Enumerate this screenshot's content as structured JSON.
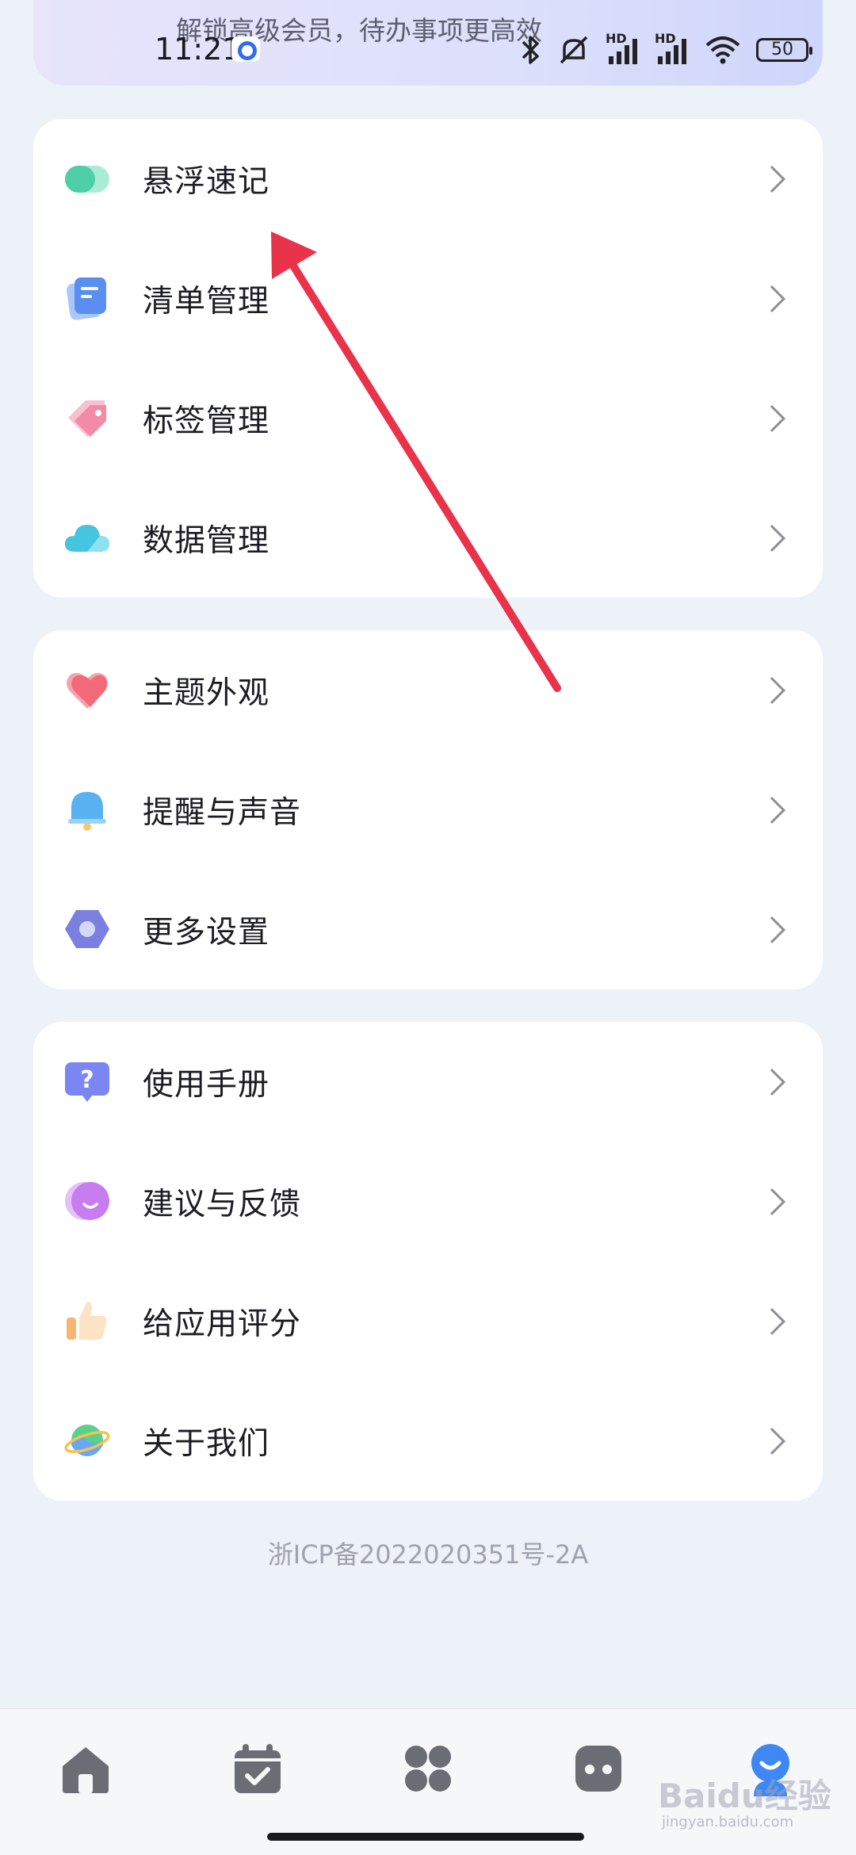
{
  "banner": {
    "text": "解锁高级会员，待办事项更高效"
  },
  "status_bar": {
    "time": "11:21",
    "battery": "50",
    "signal_labels": [
      "HD",
      "HD"
    ]
  },
  "groups": [
    {
      "items": [
        {
          "label": "悬浮速记",
          "icon": "floating-note-icon",
          "color": "#4fcfa6"
        },
        {
          "label": "清单管理",
          "icon": "list-icon",
          "color": "#5a8ef0"
        },
        {
          "label": "标签管理",
          "icon": "tag-icon",
          "color": "#f38aa8"
        },
        {
          "label": "数据管理",
          "icon": "cloud-icon",
          "color": "#47c4e0"
        }
      ]
    },
    {
      "items": [
        {
          "label": "主题外观",
          "icon": "heart-icon",
          "color": "#f26a7a"
        },
        {
          "label": "提醒与声音",
          "icon": "bell-icon",
          "color": "#58b2f2"
        },
        {
          "label": "更多设置",
          "icon": "hexagon-gear-icon",
          "color": "#7a7fe0"
        }
      ]
    },
    {
      "items": [
        {
          "label": "使用手册",
          "icon": "help-icon",
          "color": "#7c86f2"
        },
        {
          "label": "建议与反馈",
          "icon": "chat-bubble-icon",
          "color": "#c77df0"
        },
        {
          "label": "给应用评分",
          "icon": "thumb-up-icon",
          "color": "#f6b572"
        },
        {
          "label": "关于我们",
          "icon": "planet-icon",
          "color": "#5bd08c"
        }
      ]
    }
  ],
  "footer": {
    "icp": "浙ICP备2022020351号-2A"
  },
  "tabbar": {
    "tabs": [
      {
        "icon": "home-icon"
      },
      {
        "icon": "calendar-check-icon"
      },
      {
        "icon": "grid-icon"
      },
      {
        "icon": "robot-icon"
      },
      {
        "icon": "profile-icon",
        "active": true
      }
    ]
  },
  "watermark": {
    "text": "Baidu经验",
    "sub": "jingyan.baidu.com"
  },
  "colors": {
    "background": "#edf1f8",
    "card": "#ffffff",
    "arrow": "#e8334a",
    "active_tab": "#3f87f5"
  }
}
